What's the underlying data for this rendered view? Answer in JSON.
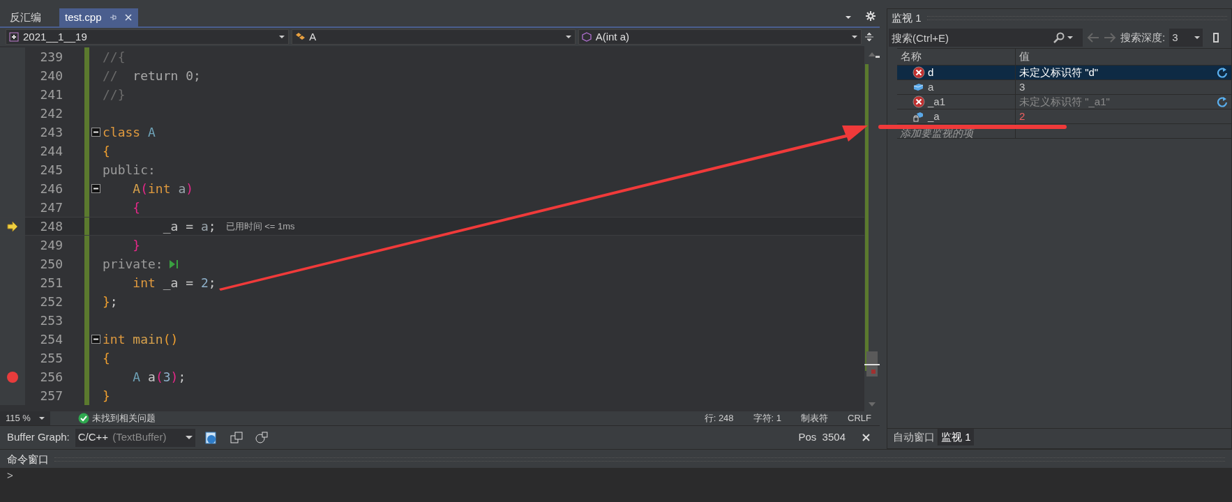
{
  "editor_tabs": [
    {
      "label": "反汇编",
      "selected": false
    },
    {
      "label": "test.cpp",
      "selected": true
    }
  ],
  "navigation": [
    {
      "kind": "project",
      "label": "2021__1__19"
    },
    {
      "kind": "class",
      "label": "A"
    },
    {
      "kind": "method",
      "label": "A(int a)"
    }
  ],
  "code_lines": [
    {
      "number": "239",
      "current": false,
      "breakpoint": false,
      "fold": false,
      "tokens": [
        {
          "text": "//{",
          "kind": "comment"
        }
      ]
    },
    {
      "number": "240",
      "current": false,
      "breakpoint": false,
      "fold": false,
      "tokens": [
        {
          "text": "//",
          "kind": "comment"
        },
        {
          "text": "  return 0;",
          "kind": "dim"
        }
      ]
    },
    {
      "number": "241",
      "current": false,
      "breakpoint": false,
      "fold": false,
      "tokens": [
        {
          "text": "//}",
          "kind": "comment"
        }
      ]
    },
    {
      "number": "242",
      "current": false,
      "breakpoint": false,
      "fold": false
    },
    {
      "number": "243",
      "current": false,
      "breakpoint": false,
      "fold": true,
      "tokens": [
        {
          "text": "class",
          "kind": "keyword"
        },
        {
          "text": " A",
          "kind": "type"
        }
      ]
    },
    {
      "number": "244",
      "current": false,
      "breakpoint": false,
      "fold": false,
      "tokens": [
        {
          "text": "{",
          "kind": "brace"
        }
      ]
    },
    {
      "number": "245",
      "current": false,
      "breakpoint": false,
      "fold": false,
      "tokens": [
        {
          "text": "public:",
          "kind": "access"
        }
      ]
    },
    {
      "number": "246",
      "current": false,
      "breakpoint": false,
      "fold": true,
      "tokens": [
        {
          "text": "    A",
          "kind": "func"
        },
        {
          "text": "(",
          "kind": "paren"
        },
        {
          "text": "int",
          "kind": "keyword"
        },
        {
          "text": " a",
          "kind": "param"
        },
        {
          "text": ")",
          "kind": "paren"
        }
      ]
    },
    {
      "number": "247",
      "current": false,
      "breakpoint": false,
      "fold": false,
      "tokens": [
        {
          "text": "    {",
          "kind": "paren"
        }
      ]
    },
    {
      "number": "248",
      "current": true,
      "breakpoint": false,
      "fold": false,
      "hint": "已用时间 <= 1ms",
      "tokens": [
        {
          "text": "        _a = ",
          "kind": "plain"
        },
        {
          "text": "a",
          "kind": "param"
        },
        {
          "text": ";",
          "kind": "plain"
        }
      ]
    },
    {
      "number": "249",
      "current": false,
      "breakpoint": false,
      "fold": false,
      "tokens": [
        {
          "text": "    }",
          "kind": "paren"
        }
      ]
    },
    {
      "number": "250",
      "current": false,
      "breakpoint": false,
      "fold": false,
      "run_to_cursor": true,
      "tokens": [
        {
          "text": "private:",
          "kind": "access"
        }
      ]
    },
    {
      "number": "251",
      "current": false,
      "breakpoint": false,
      "fold": false,
      "tokens": [
        {
          "text": "    int",
          "kind": "keyword"
        },
        {
          "text": " _a = ",
          "kind": "plain"
        },
        {
          "text": "2",
          "kind": "number"
        },
        {
          "text": ";",
          "kind": "plain"
        }
      ]
    },
    {
      "number": "252",
      "current": false,
      "breakpoint": false,
      "fold": false,
      "tokens": [
        {
          "text": "}",
          "kind": "brace"
        },
        {
          "text": ";",
          "kind": "plain"
        }
      ]
    },
    {
      "number": "253",
      "current": false,
      "breakpoint": false,
      "fold": false
    },
    {
      "number": "254",
      "current": false,
      "breakpoint": false,
      "fold": true,
      "tokens": [
        {
          "text": "int",
          "kind": "keyword"
        },
        {
          "text": " main",
          "kind": "func"
        },
        {
          "text": "()",
          "kind": "brace"
        }
      ]
    },
    {
      "number": "255",
      "current": false,
      "breakpoint": false,
      "fold": false,
      "tokens": [
        {
          "text": "{",
          "kind": "brace"
        }
      ]
    },
    {
      "number": "256",
      "current": false,
      "breakpoint": true,
      "fold": false,
      "tokens": [
        {
          "text": "    A",
          "kind": "type"
        },
        {
          "text": " a",
          "kind": "plain"
        },
        {
          "text": "(",
          "kind": "paren"
        },
        {
          "text": "3",
          "kind": "number"
        },
        {
          "text": ")",
          "kind": "paren"
        },
        {
          "text": ";",
          "kind": "plain"
        }
      ]
    },
    {
      "number": "257",
      "current": false,
      "breakpoint": false,
      "fold": false,
      "tokens": [
        {
          "text": "}",
          "kind": "brace"
        }
      ]
    }
  ],
  "status_bar": {
    "zoom": "115 %",
    "issues": "未找到相关问题",
    "line": "行: 248",
    "char": "字符: 1",
    "indent": "制表符",
    "eol": "CRLF"
  },
  "buffer_graph": {
    "label": "Buffer Graph:",
    "language": "C/C++",
    "buffer": "(TextBuffer)",
    "position": "Pos  3504"
  },
  "command_window": {
    "title": "命令窗口",
    "prompt": ">"
  },
  "watch": {
    "title": "监视 1",
    "search_placeholder": "搜索(Ctrl+E)",
    "depth_label": "搜索深度:",
    "depth": "3",
    "columns": [
      "名称",
      "值"
    ],
    "rows": [
      {
        "name": "d",
        "value": "未定义标识符 \"d\"",
        "kind": "error",
        "selected": true,
        "changed": false
      },
      {
        "name": "a",
        "value": "3",
        "kind": "local",
        "selected": false,
        "changed": false
      },
      {
        "name": "_a1",
        "value": "未定义标识符 \"_a1\"",
        "kind": "error",
        "selected": false,
        "changed": false
      },
      {
        "name": "_a",
        "value": "2",
        "kind": "field",
        "selected": false,
        "changed": true
      }
    ],
    "add_placeholder": "添加要监视的项",
    "tabs": [
      {
        "label": "自动窗口",
        "selected": false
      },
      {
        "label": "监视 1",
        "selected": true
      }
    ]
  }
}
